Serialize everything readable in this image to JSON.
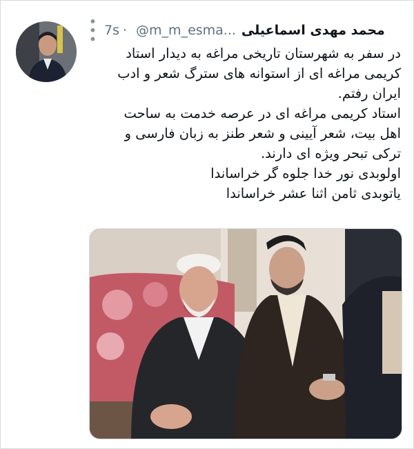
{
  "tweet": {
    "author_name": "محمد مهدی اسماعیلی",
    "handle": "@m_m_esma...",
    "separator": "·",
    "time": "7s",
    "more_icon": "more-options-icon",
    "lines": [
      "در سفر به شهرستان تاریخی مراغه به دیدار استاد",
      "کریمی مراغه ای از استوانه های سترگ شعر و ادب",
      "ایران رفتم.",
      "استاد کریمی مراغه ای در عرصه خدمت به ساحت",
      "اهل بیت، شعر آیینی و شعر طنز به زبان فارسی و",
      "ترکی تبحر ویژه ای دارند.",
      "اولوبدی نور خدا جلوه گر خراساندا",
      "یاتوبدی ثامن اثنا عشر خراساندا"
    ]
  },
  "colors": {
    "text": "#0f1419",
    "muted": "#5b7083",
    "border": "#cfd9de"
  }
}
